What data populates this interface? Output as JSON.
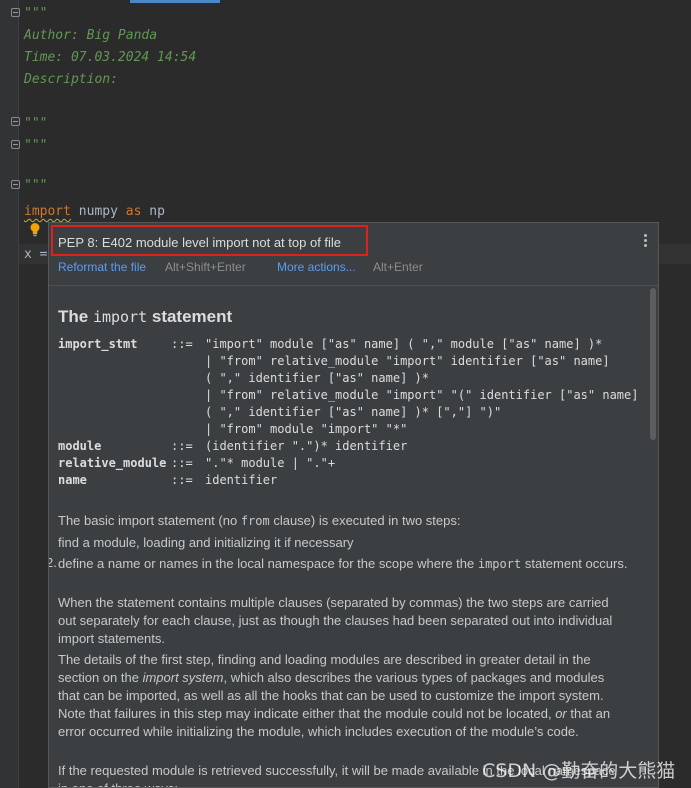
{
  "editor": {
    "lines": {
      "doc_open_1": "\"\"\"",
      "author": "Author: Big Panda",
      "time": "Time: 07.03.2024 14:54",
      "description": "Description:",
      "doc_close_1": "\"\"\"",
      "doc_open_2": "\"\"\"",
      "doc_open_3": "\"\"\"",
      "import_kw": "import",
      "import_mod": " numpy ",
      "as_kw": "as",
      "import_alias": " np",
      "x_assign": "x ="
    },
    "icons": {
      "bulb": "lightbulb-icon",
      "fold": "fold-marker-icon"
    }
  },
  "popup": {
    "error_message": "PEP 8: E402 module level import not at top of file",
    "actions": {
      "reformat_label": "Reformat the file",
      "reformat_shortcut": "Alt+Shift+Enter",
      "more_label": "More actions...",
      "more_shortcut": "Alt+Enter"
    },
    "doc": {
      "title_prefix": "The ",
      "title_code": "import",
      "title_suffix": " statement",
      "grammar_names": [
        "import_stmt",
        "module",
        "relative_module",
        "name"
      ],
      "grammar_ops": [
        "::=",
        "::=",
        "::=",
        "::="
      ],
      "grammar_rules": [
        "\"import\" module [\"as\" name] ( \",\" module [\"as\" name] )*",
        "| \"from\" relative_module \"import\" identifier [\"as\" name]",
        "( \",\" identifier [\"as\" name] )*",
        "| \"from\" relative_module \"import\" \"(\" identifier [\"as\" name]",
        "( \",\" identifier [\"as\" name] )* [\",\"] \")\"",
        "| \"from\" module \"import\" \"*\"",
        "(identifier \".\")* identifier",
        "\".\"* module | \".\"+",
        "identifier"
      ],
      "p1_a": "The basic import statement (no ",
      "p1_code": "from",
      "p1_b": " clause) is executed in two steps:",
      "step1_num": ".",
      "step1": "find a module, loading and initializing it if necessary",
      "step2_num": "2.",
      "step2_a": "define a name or names in the local namespace for the scope where the ",
      "step2_code": "import",
      "step2_b": " statement occurs.",
      "p2": "When the statement contains multiple clauses (separated by commas) the two steps are carried out separately for each clause, just as though the clauses had been separated out into individual import statements.",
      "p3_a": "The details of the first step, finding and loading modules are described in greater detail in the section on the ",
      "p3_em": "import system",
      "p3_b": ", which also describes the various types of packages and modules that can be imported, as well as all the hooks that can be used to customize the import system. Note that failures in this step may indicate either that the module could not be located, ",
      "p3_em2": "or",
      "p3_c": " that an error occurred while initializing the module, which includes execution of the module’s code.",
      "p4": "If the requested module is retrieved successfully, it will be made available in the local namespace in one of three ways:"
    }
  },
  "watermark": "CSDN @勤奋的大熊猫"
}
